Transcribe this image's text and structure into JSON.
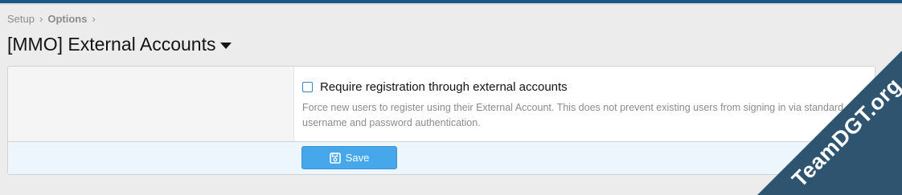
{
  "breadcrumb": {
    "items": [
      "Setup",
      "Options"
    ]
  },
  "page": {
    "title": "[MMO] External Accounts"
  },
  "option": {
    "checkbox_label": "Require registration through external accounts",
    "checked": false,
    "explain": "Force new users to register using their External Account. This does not prevent existing users from signing in via standard username and password authentication."
  },
  "footer": {
    "save_label": "Save"
  },
  "watermark": {
    "text": "TeamDGT.org"
  },
  "colors": {
    "accent": "#47a7eb",
    "top_bar": "#185886",
    "watermark_bg": "#2f5470"
  }
}
